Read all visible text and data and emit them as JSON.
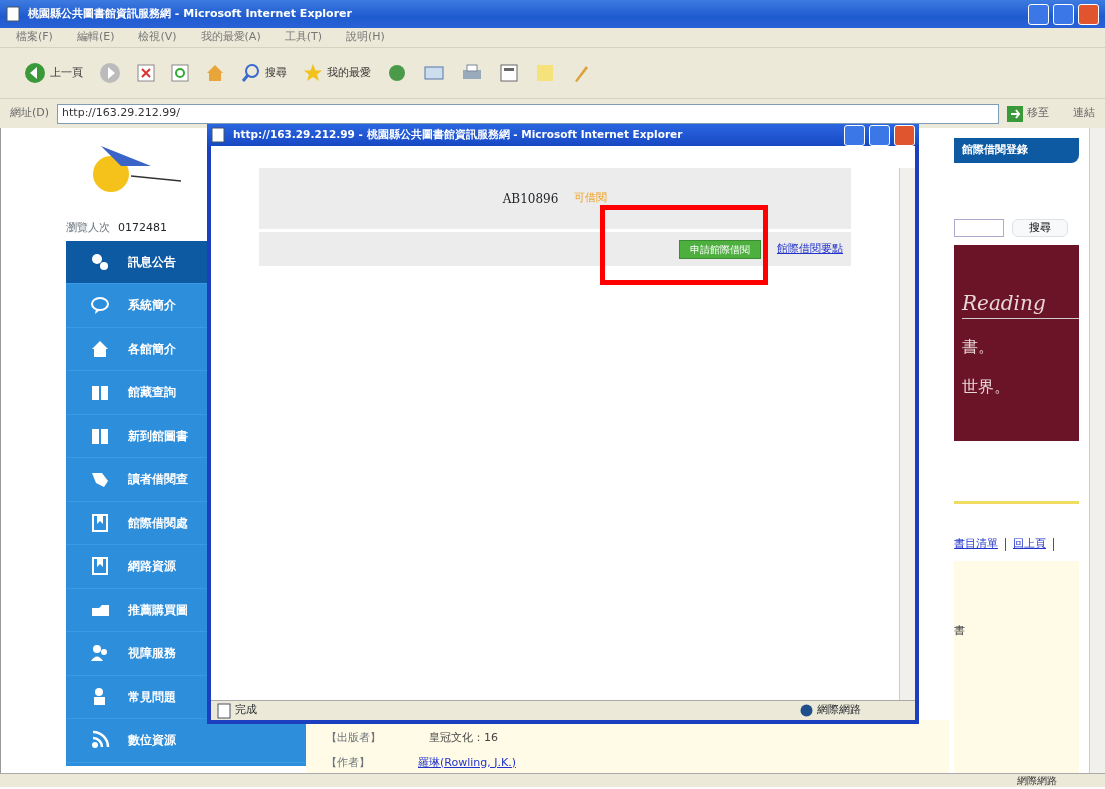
{
  "window": {
    "title": "桃園縣公共圖書館資訊服務網 - Microsoft Internet Explorer"
  },
  "menu": [
    "檔案(F)",
    "編輯(E)",
    "檢視(V)",
    "我的最愛(A)",
    "工具(T)",
    "說明(H)"
  ],
  "toolbar": {
    "back": "上一頁",
    "search": "搜尋",
    "favorites": "我的最愛"
  },
  "address_bar": {
    "label": "網址(D)",
    "value": "http://163.29.212.99/",
    "go": "移至",
    "links": "連結"
  },
  "page": {
    "visitors_label": "瀏覽人次",
    "visitors_count": "0172481",
    "sidebar": [
      {
        "label": "訊息公告",
        "selected": true
      },
      {
        "label": "系統簡介",
        "selected": false
      },
      {
        "label": "各館簡介",
        "selected": false
      },
      {
        "label": "館藏查詢",
        "selected": false
      },
      {
        "label": "新到館圖書",
        "selected": false
      },
      {
        "label": "讀者借閱查",
        "selected": false
      },
      {
        "label": "館際借閱處",
        "selected": false
      },
      {
        "label": "網路資源",
        "selected": false
      },
      {
        "label": "推薦購買圖",
        "selected": false
      },
      {
        "label": "視障服務",
        "selected": false
      },
      {
        "label": "常見問題",
        "selected": false
      },
      {
        "label": "數位資源",
        "selected": false
      }
    ],
    "top_tab": "館際借閱登錄",
    "search_button": "搜尋",
    "banner": {
      "title": "Reading",
      "line_1": "書。",
      "line_2": "世界。"
    },
    "links": [
      "書目清單",
      "回上頁"
    ],
    "fields": [
      {
        "label": "【出版者】",
        "value": "皇冠文化：16",
        "kind": "text"
      },
      {
        "label": "【作者】",
        "value": "羅琳(Rowling, J.K.)",
        "kind": "link"
      }
    ],
    "side_fragment": "書"
  },
  "popup": {
    "title": "http://163.29.212.99 - 桃園縣公共圖書館資訊服務網 - Microsoft Internet Explorer",
    "call_number": "AB10896",
    "availability": "可借閱",
    "apply_button": "申請館際借閱",
    "rules_link": "館際借閱要點",
    "status": "完成",
    "zone": "網際網路",
    "highlighted": true
  },
  "status_bar": {
    "zone": "網際網路"
  }
}
